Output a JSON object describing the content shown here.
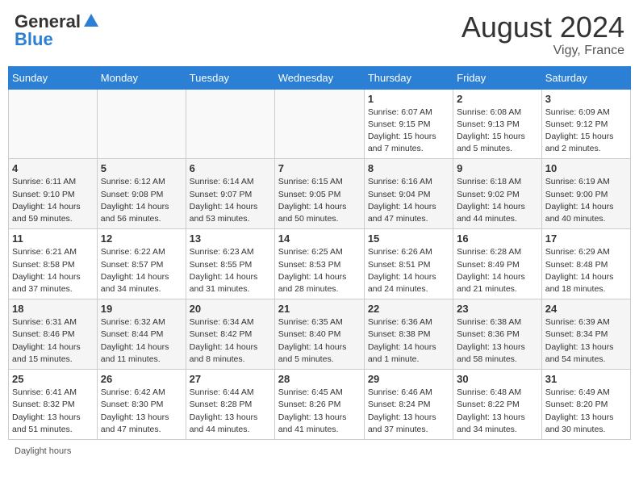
{
  "header": {
    "logo_general": "General",
    "logo_blue": "Blue",
    "month_title": "August 2024",
    "location": "Vigy, France"
  },
  "days_of_week": [
    "Sunday",
    "Monday",
    "Tuesday",
    "Wednesday",
    "Thursday",
    "Friday",
    "Saturday"
  ],
  "weeks": [
    [
      {
        "day": "",
        "info": ""
      },
      {
        "day": "",
        "info": ""
      },
      {
        "day": "",
        "info": ""
      },
      {
        "day": "",
        "info": ""
      },
      {
        "day": "1",
        "info": "Sunrise: 6:07 AM\nSunset: 9:15 PM\nDaylight: 15 hours and 7 minutes."
      },
      {
        "day": "2",
        "info": "Sunrise: 6:08 AM\nSunset: 9:13 PM\nDaylight: 15 hours and 5 minutes."
      },
      {
        "day": "3",
        "info": "Sunrise: 6:09 AM\nSunset: 9:12 PM\nDaylight: 15 hours and 2 minutes."
      }
    ],
    [
      {
        "day": "4",
        "info": "Sunrise: 6:11 AM\nSunset: 9:10 PM\nDaylight: 14 hours and 59 minutes."
      },
      {
        "day": "5",
        "info": "Sunrise: 6:12 AM\nSunset: 9:08 PM\nDaylight: 14 hours and 56 minutes."
      },
      {
        "day": "6",
        "info": "Sunrise: 6:14 AM\nSunset: 9:07 PM\nDaylight: 14 hours and 53 minutes."
      },
      {
        "day": "7",
        "info": "Sunrise: 6:15 AM\nSunset: 9:05 PM\nDaylight: 14 hours and 50 minutes."
      },
      {
        "day": "8",
        "info": "Sunrise: 6:16 AM\nSunset: 9:04 PM\nDaylight: 14 hours and 47 minutes."
      },
      {
        "day": "9",
        "info": "Sunrise: 6:18 AM\nSunset: 9:02 PM\nDaylight: 14 hours and 44 minutes."
      },
      {
        "day": "10",
        "info": "Sunrise: 6:19 AM\nSunset: 9:00 PM\nDaylight: 14 hours and 40 minutes."
      }
    ],
    [
      {
        "day": "11",
        "info": "Sunrise: 6:21 AM\nSunset: 8:58 PM\nDaylight: 14 hours and 37 minutes."
      },
      {
        "day": "12",
        "info": "Sunrise: 6:22 AM\nSunset: 8:57 PM\nDaylight: 14 hours and 34 minutes."
      },
      {
        "day": "13",
        "info": "Sunrise: 6:23 AM\nSunset: 8:55 PM\nDaylight: 14 hours and 31 minutes."
      },
      {
        "day": "14",
        "info": "Sunrise: 6:25 AM\nSunset: 8:53 PM\nDaylight: 14 hours and 28 minutes."
      },
      {
        "day": "15",
        "info": "Sunrise: 6:26 AM\nSunset: 8:51 PM\nDaylight: 14 hours and 24 minutes."
      },
      {
        "day": "16",
        "info": "Sunrise: 6:28 AM\nSunset: 8:49 PM\nDaylight: 14 hours and 21 minutes."
      },
      {
        "day": "17",
        "info": "Sunrise: 6:29 AM\nSunset: 8:48 PM\nDaylight: 14 hours and 18 minutes."
      }
    ],
    [
      {
        "day": "18",
        "info": "Sunrise: 6:31 AM\nSunset: 8:46 PM\nDaylight: 14 hours and 15 minutes."
      },
      {
        "day": "19",
        "info": "Sunrise: 6:32 AM\nSunset: 8:44 PM\nDaylight: 14 hours and 11 minutes."
      },
      {
        "day": "20",
        "info": "Sunrise: 6:34 AM\nSunset: 8:42 PM\nDaylight: 14 hours and 8 minutes."
      },
      {
        "day": "21",
        "info": "Sunrise: 6:35 AM\nSunset: 8:40 PM\nDaylight: 14 hours and 5 minutes."
      },
      {
        "day": "22",
        "info": "Sunrise: 6:36 AM\nSunset: 8:38 PM\nDaylight: 14 hours and 1 minute."
      },
      {
        "day": "23",
        "info": "Sunrise: 6:38 AM\nSunset: 8:36 PM\nDaylight: 13 hours and 58 minutes."
      },
      {
        "day": "24",
        "info": "Sunrise: 6:39 AM\nSunset: 8:34 PM\nDaylight: 13 hours and 54 minutes."
      }
    ],
    [
      {
        "day": "25",
        "info": "Sunrise: 6:41 AM\nSunset: 8:32 PM\nDaylight: 13 hours and 51 minutes."
      },
      {
        "day": "26",
        "info": "Sunrise: 6:42 AM\nSunset: 8:30 PM\nDaylight: 13 hours and 47 minutes."
      },
      {
        "day": "27",
        "info": "Sunrise: 6:44 AM\nSunset: 8:28 PM\nDaylight: 13 hours and 44 minutes."
      },
      {
        "day": "28",
        "info": "Sunrise: 6:45 AM\nSunset: 8:26 PM\nDaylight: 13 hours and 41 minutes."
      },
      {
        "day": "29",
        "info": "Sunrise: 6:46 AM\nSunset: 8:24 PM\nDaylight: 13 hours and 37 minutes."
      },
      {
        "day": "30",
        "info": "Sunrise: 6:48 AM\nSunset: 8:22 PM\nDaylight: 13 hours and 34 minutes."
      },
      {
        "day": "31",
        "info": "Sunrise: 6:49 AM\nSunset: 8:20 PM\nDaylight: 13 hours and 30 minutes."
      }
    ]
  ],
  "footer": {
    "daylight_hours": "Daylight hours"
  }
}
